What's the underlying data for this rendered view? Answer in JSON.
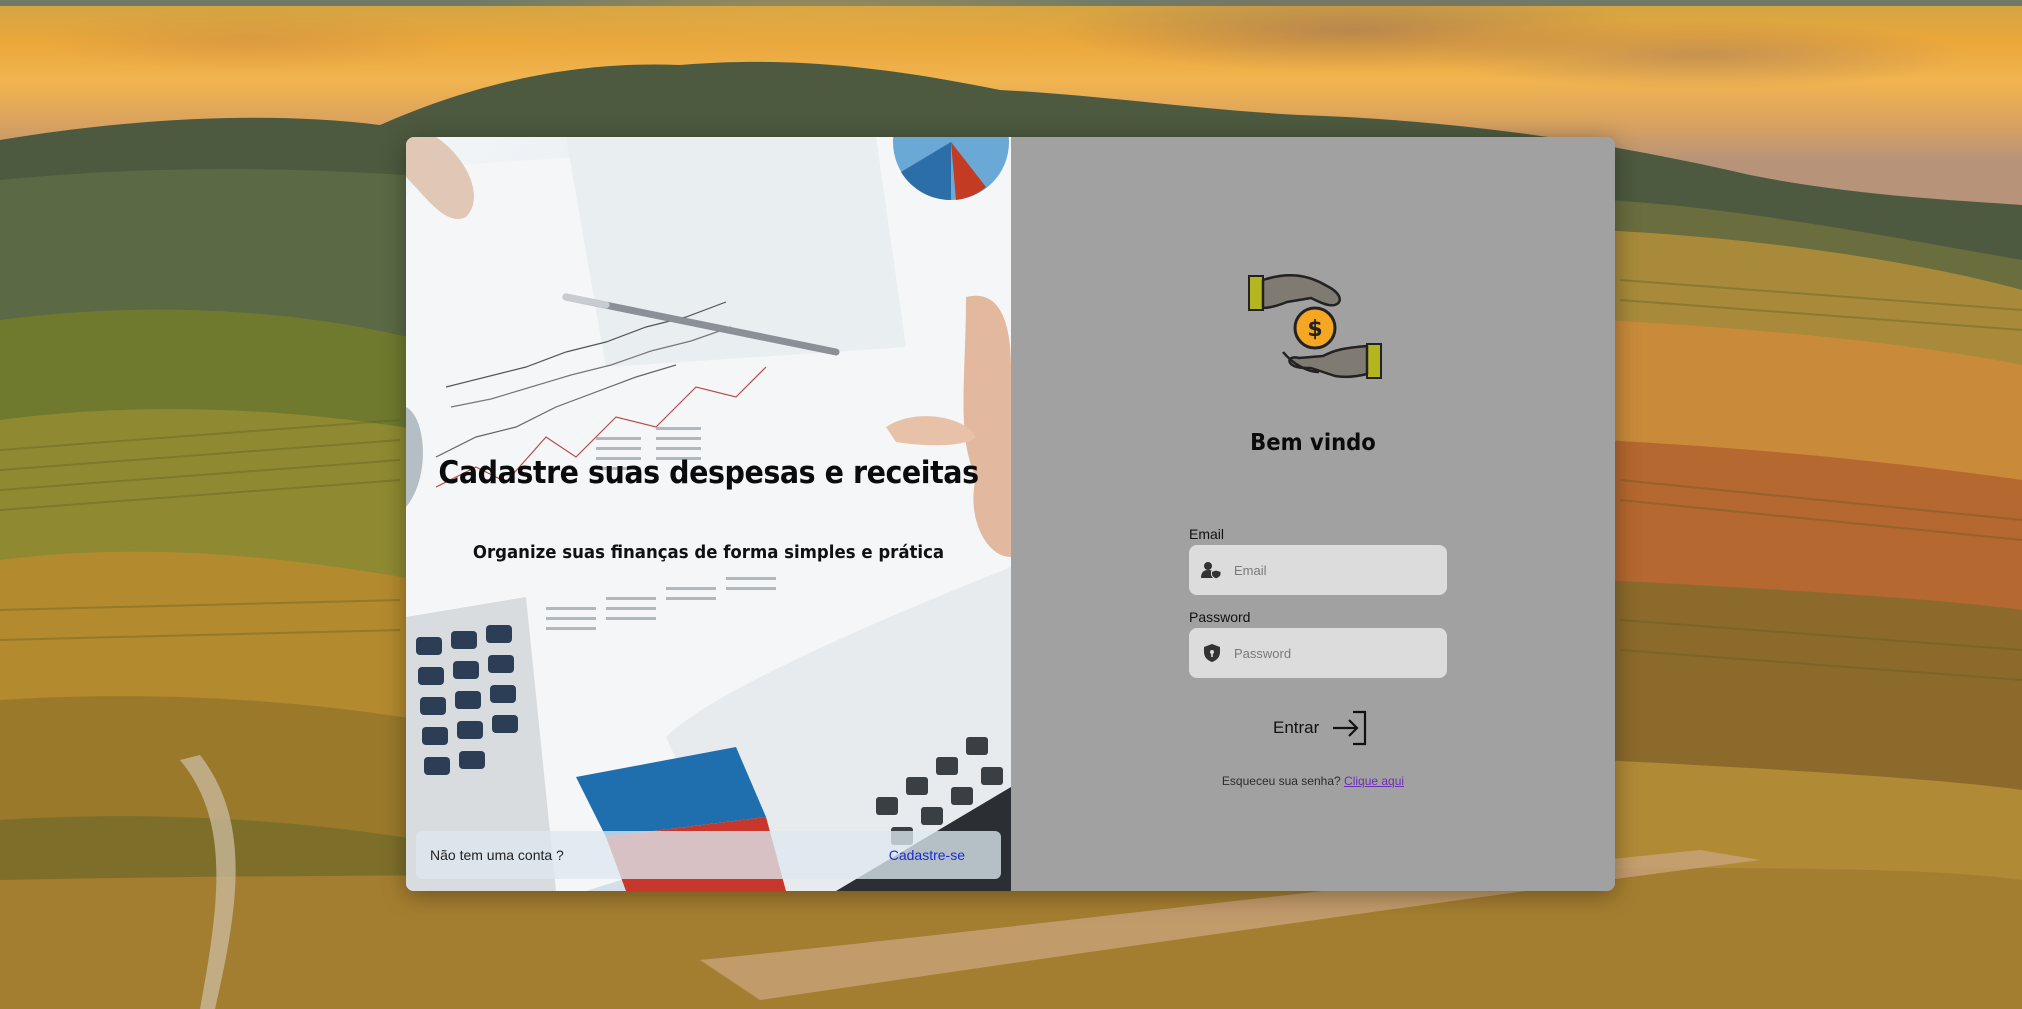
{
  "hero": {
    "title": "Cadastre suas despesas e receitas",
    "subtitle": "Organize suas finanças de forma simples e prática"
  },
  "signup": {
    "question": "Não tem uma conta ?",
    "link_label": "Cadastre-se"
  },
  "login": {
    "welcome": "Bem vindo",
    "email_label": "Email",
    "email_placeholder": "Email",
    "password_label": "Password",
    "password_placeholder": "Password",
    "submit_label": "Entrar",
    "forgot_text": "Esqueceu sua senha?",
    "forgot_link": "Clique aqui"
  },
  "icons": {
    "logo": "hands-coin-icon",
    "email": "user-shield-icon",
    "password": "shield-icon",
    "submit": "sign-in-arrow-icon"
  },
  "colors": {
    "panel_bg": "#a2a1a2",
    "input_bg": "#dcdcdc",
    "link_blue": "#1a2ccf",
    "link_purple": "#6a2fb5",
    "coin": "#f5a623",
    "cuff": "#b5b51f"
  }
}
